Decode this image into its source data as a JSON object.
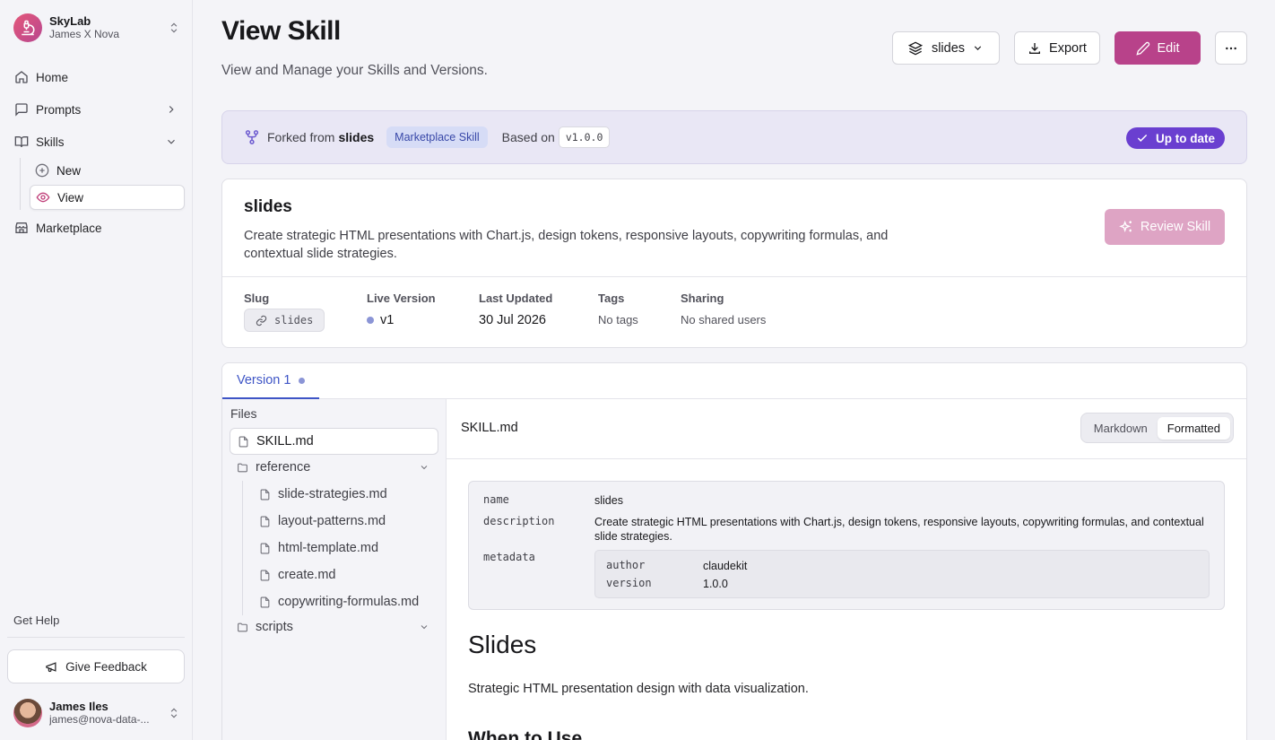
{
  "sidebar": {
    "org_name": "SkyLab",
    "org_user": "James X Nova",
    "nav": {
      "home": "Home",
      "prompts": "Prompts",
      "skills": "Skills",
      "skills_new": "New",
      "skills_view": "View",
      "marketplace": "Marketplace"
    },
    "get_help": "Get Help",
    "feedback": "Give Feedback",
    "user_name": "James Iles",
    "user_email": "james@nova-data-..."
  },
  "header": {
    "title": "View Skill",
    "subtitle": "View and Manage your Skills and Versions.",
    "skill_select": "slides",
    "export_label": "Export",
    "edit_label": "Edit"
  },
  "fork": {
    "prefix": "Forked from",
    "source": "slides",
    "badge": "Marketplace Skill",
    "based_on": "Based on",
    "version": "v1.0.0",
    "status": "Up to date"
  },
  "skill": {
    "name": "slides",
    "description": "Create strategic HTML presentations with Chart.js, design tokens, responsive layouts, copywriting formulas, and contextual slide strategies.",
    "review_label": "Review Skill",
    "meta": {
      "slug_label": "Slug",
      "slug": "slides",
      "live_label": "Live Version",
      "live": "v1",
      "updated_label": "Last Updated",
      "updated": "30 Jul 2026",
      "tags_label": "Tags",
      "tags": "No tags",
      "sharing_label": "Sharing",
      "sharing": "No shared users"
    }
  },
  "versions": {
    "tab": "Version 1",
    "files_label": "Files",
    "files": {
      "skill": "SKILL.md",
      "reference": "reference",
      "ref1": "slide-strategies.md",
      "ref2": "layout-patterns.md",
      "ref3": "html-template.md",
      "ref4": "create.md",
      "ref5": "copywriting-formulas.md",
      "scripts": "scripts"
    },
    "viewer": {
      "file": "SKILL.md",
      "mode_markdown": "Markdown",
      "mode_formatted": "Formatted",
      "frontmatter": {
        "name_key": "name",
        "name_val": "slides",
        "desc_key": "description",
        "desc_val": "Create strategic HTML presentations with Chart.js, design tokens, responsive layouts, copywriting formulas, and contextual slide strategies.",
        "meta_key": "metadata",
        "author_key": "author",
        "author_val": "claudekit",
        "version_key": "version",
        "version_val": "1.0.0"
      },
      "h1": "Slides",
      "intro": "Strategic HTML presentation design with data visualization.",
      "h2": "When to Use"
    }
  },
  "colors": {
    "accent": "#b8428a",
    "status": "#6a3fd0",
    "tab": "#3e55c6"
  }
}
